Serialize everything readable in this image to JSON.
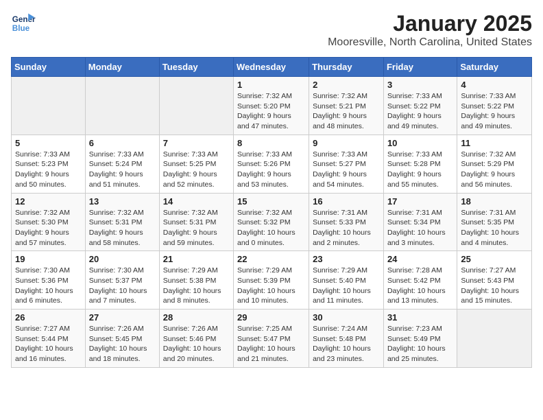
{
  "logo": {
    "line1": "General",
    "line2": "Blue"
  },
  "title": "January 2025",
  "location": "Mooresville, North Carolina, United States",
  "days_of_week": [
    "Sunday",
    "Monday",
    "Tuesday",
    "Wednesday",
    "Thursday",
    "Friday",
    "Saturday"
  ],
  "weeks": [
    [
      {
        "day": "",
        "info": ""
      },
      {
        "day": "",
        "info": ""
      },
      {
        "day": "",
        "info": ""
      },
      {
        "day": "1",
        "info": "Sunrise: 7:32 AM\nSunset: 5:20 PM\nDaylight: 9 hours and 47 minutes."
      },
      {
        "day": "2",
        "info": "Sunrise: 7:32 AM\nSunset: 5:21 PM\nDaylight: 9 hours and 48 minutes."
      },
      {
        "day": "3",
        "info": "Sunrise: 7:33 AM\nSunset: 5:22 PM\nDaylight: 9 hours and 49 minutes."
      },
      {
        "day": "4",
        "info": "Sunrise: 7:33 AM\nSunset: 5:22 PM\nDaylight: 9 hours and 49 minutes."
      }
    ],
    [
      {
        "day": "5",
        "info": "Sunrise: 7:33 AM\nSunset: 5:23 PM\nDaylight: 9 hours and 50 minutes."
      },
      {
        "day": "6",
        "info": "Sunrise: 7:33 AM\nSunset: 5:24 PM\nDaylight: 9 hours and 51 minutes."
      },
      {
        "day": "7",
        "info": "Sunrise: 7:33 AM\nSunset: 5:25 PM\nDaylight: 9 hours and 52 minutes."
      },
      {
        "day": "8",
        "info": "Sunrise: 7:33 AM\nSunset: 5:26 PM\nDaylight: 9 hours and 53 minutes."
      },
      {
        "day": "9",
        "info": "Sunrise: 7:33 AM\nSunset: 5:27 PM\nDaylight: 9 hours and 54 minutes."
      },
      {
        "day": "10",
        "info": "Sunrise: 7:33 AM\nSunset: 5:28 PM\nDaylight: 9 hours and 55 minutes."
      },
      {
        "day": "11",
        "info": "Sunrise: 7:32 AM\nSunset: 5:29 PM\nDaylight: 9 hours and 56 minutes."
      }
    ],
    [
      {
        "day": "12",
        "info": "Sunrise: 7:32 AM\nSunset: 5:30 PM\nDaylight: 9 hours and 57 minutes."
      },
      {
        "day": "13",
        "info": "Sunrise: 7:32 AM\nSunset: 5:31 PM\nDaylight: 9 hours and 58 minutes."
      },
      {
        "day": "14",
        "info": "Sunrise: 7:32 AM\nSunset: 5:31 PM\nDaylight: 9 hours and 59 minutes."
      },
      {
        "day": "15",
        "info": "Sunrise: 7:32 AM\nSunset: 5:32 PM\nDaylight: 10 hours and 0 minutes."
      },
      {
        "day": "16",
        "info": "Sunrise: 7:31 AM\nSunset: 5:33 PM\nDaylight: 10 hours and 2 minutes."
      },
      {
        "day": "17",
        "info": "Sunrise: 7:31 AM\nSunset: 5:34 PM\nDaylight: 10 hours and 3 minutes."
      },
      {
        "day": "18",
        "info": "Sunrise: 7:31 AM\nSunset: 5:35 PM\nDaylight: 10 hours and 4 minutes."
      }
    ],
    [
      {
        "day": "19",
        "info": "Sunrise: 7:30 AM\nSunset: 5:36 PM\nDaylight: 10 hours and 6 minutes."
      },
      {
        "day": "20",
        "info": "Sunrise: 7:30 AM\nSunset: 5:37 PM\nDaylight: 10 hours and 7 minutes."
      },
      {
        "day": "21",
        "info": "Sunrise: 7:29 AM\nSunset: 5:38 PM\nDaylight: 10 hours and 8 minutes."
      },
      {
        "day": "22",
        "info": "Sunrise: 7:29 AM\nSunset: 5:39 PM\nDaylight: 10 hours and 10 minutes."
      },
      {
        "day": "23",
        "info": "Sunrise: 7:29 AM\nSunset: 5:40 PM\nDaylight: 10 hours and 11 minutes."
      },
      {
        "day": "24",
        "info": "Sunrise: 7:28 AM\nSunset: 5:42 PM\nDaylight: 10 hours and 13 minutes."
      },
      {
        "day": "25",
        "info": "Sunrise: 7:27 AM\nSunset: 5:43 PM\nDaylight: 10 hours and 15 minutes."
      }
    ],
    [
      {
        "day": "26",
        "info": "Sunrise: 7:27 AM\nSunset: 5:44 PM\nDaylight: 10 hours and 16 minutes."
      },
      {
        "day": "27",
        "info": "Sunrise: 7:26 AM\nSunset: 5:45 PM\nDaylight: 10 hours and 18 minutes."
      },
      {
        "day": "28",
        "info": "Sunrise: 7:26 AM\nSunset: 5:46 PM\nDaylight: 10 hours and 20 minutes."
      },
      {
        "day": "29",
        "info": "Sunrise: 7:25 AM\nSunset: 5:47 PM\nDaylight: 10 hours and 21 minutes."
      },
      {
        "day": "30",
        "info": "Sunrise: 7:24 AM\nSunset: 5:48 PM\nDaylight: 10 hours and 23 minutes."
      },
      {
        "day": "31",
        "info": "Sunrise: 7:23 AM\nSunset: 5:49 PM\nDaylight: 10 hours and 25 minutes."
      },
      {
        "day": "",
        "info": ""
      }
    ]
  ]
}
